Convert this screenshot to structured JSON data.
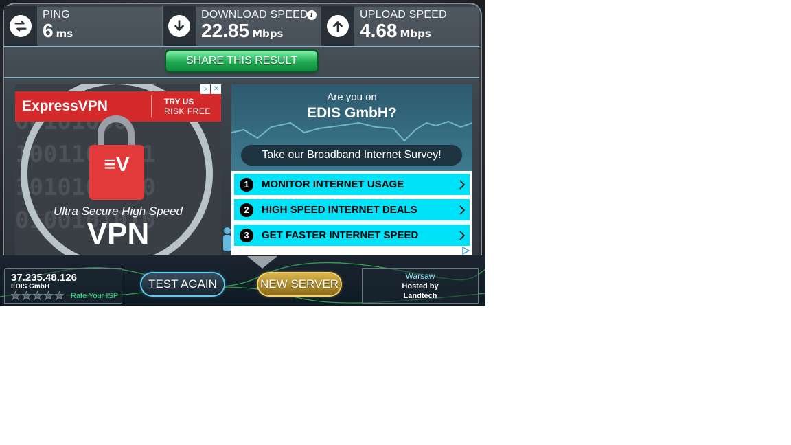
{
  "stats": {
    "ping": {
      "label": "PING",
      "value": "6",
      "unit": "ms",
      "icon": "swap-arrows-icon"
    },
    "download": {
      "label": "DOWNLOAD SPEED",
      "value": "22.85",
      "unit": "Mbps",
      "icon": "arrow-down-icon",
      "info": "i"
    },
    "upload": {
      "label": "UPLOAD SPEED",
      "value": "4.68",
      "unit": "Mbps",
      "icon": "arrow-up-icon"
    }
  },
  "share": {
    "label": "SHARE THIS RESULT"
  },
  "vpn_ad": {
    "logo": "ExpressVPN",
    "try_line1": "TRY US",
    "try_line2": "RISK FREE",
    "lock_glyph": "≡V",
    "tagline": "Ultra Secure High Speed",
    "big": "VPN",
    "bits": [
      "00101000",
      "1001101101",
      "1010100110",
      "0100101010"
    ]
  },
  "survey_ad": {
    "q1": "Are you on",
    "q2": "EDIS GmbH?",
    "cta": "Take our Broadband Internet Survey!",
    "items": [
      {
        "num": "1",
        "label": "MONITOR INTERNET USAGE"
      },
      {
        "num": "2",
        "label": "HIGH SPEED INTERNET DEALS"
      },
      {
        "num": "3",
        "label": "GET FASTER INTERNET SPEED"
      }
    ]
  },
  "footer": {
    "ip": "37.235.48.126",
    "isp": "EDIS GmbH",
    "rate_label": "Rate Your ISP",
    "stars_rating": 0,
    "test_again": "TEST AGAIN",
    "new_server": "NEW SERVER",
    "server_city": "Warsaw",
    "hosted_by": "Hosted by",
    "host": "Landtech"
  },
  "colors": {
    "share_green": "#1faa52",
    "survey_cyan": "#00e2f8",
    "vpn_red": "#d42a2c",
    "accent_blue": "#5fc8ec",
    "gold": "#d8b44c"
  }
}
